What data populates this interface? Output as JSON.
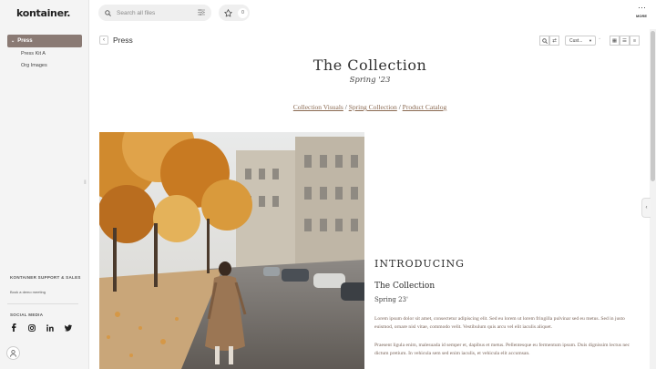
{
  "brand": {
    "logo_text": "kontainer."
  },
  "sidebar": {
    "active_item": {
      "label": "Press"
    },
    "sub_items": [
      {
        "label": "Press Kit A"
      },
      {
        "label": "Org Images"
      }
    ],
    "support_title": "KONTAINER SUPPORT & SALES",
    "demo_link": "Book a demo meeting",
    "social_title": "SOCIAL MEDIA",
    "social_icons": [
      "facebook-icon",
      "instagram-icon",
      "linkedin-icon",
      "twitter-icon"
    ]
  },
  "topbar": {
    "search_placeholder": "Search all files",
    "favorites_count": "0",
    "more_label": "MORE"
  },
  "page": {
    "title": "Press",
    "view_select": "Cust..."
  },
  "hero": {
    "title": "The Collection",
    "subtitle": "Spring '23",
    "links": [
      "Collection Visuals",
      "Spring Collection",
      "Product Catalog"
    ],
    "separator": " / "
  },
  "article": {
    "heading": "INTRODUCING",
    "title": "The Collection",
    "subtitle": "Spring 23'",
    "paragraph_1": "Lorem ipsum dolor sit amet, consectetur adipiscing elit. Sed eu lorem ut lorem fringilla pulvinar sed eu metus. Sed in justo euismod, ornare nisl vitae, commodo velit. Vestibulum quis arcu vel elit iaculis aliquet.",
    "paragraph_2": "Praesent ligula enim, malesuada id semper et, dapibus et metus. Pellentesque eu fermentum ipsum. Duis dignissim lectus nec dictum pretium. In vehicula sem sed enim iaculis, et vehicula elit accumsan."
  },
  "colors": {
    "sidebar_active": "#8a7a74",
    "link": "#8b6a52",
    "body_text": "#7a6459"
  }
}
